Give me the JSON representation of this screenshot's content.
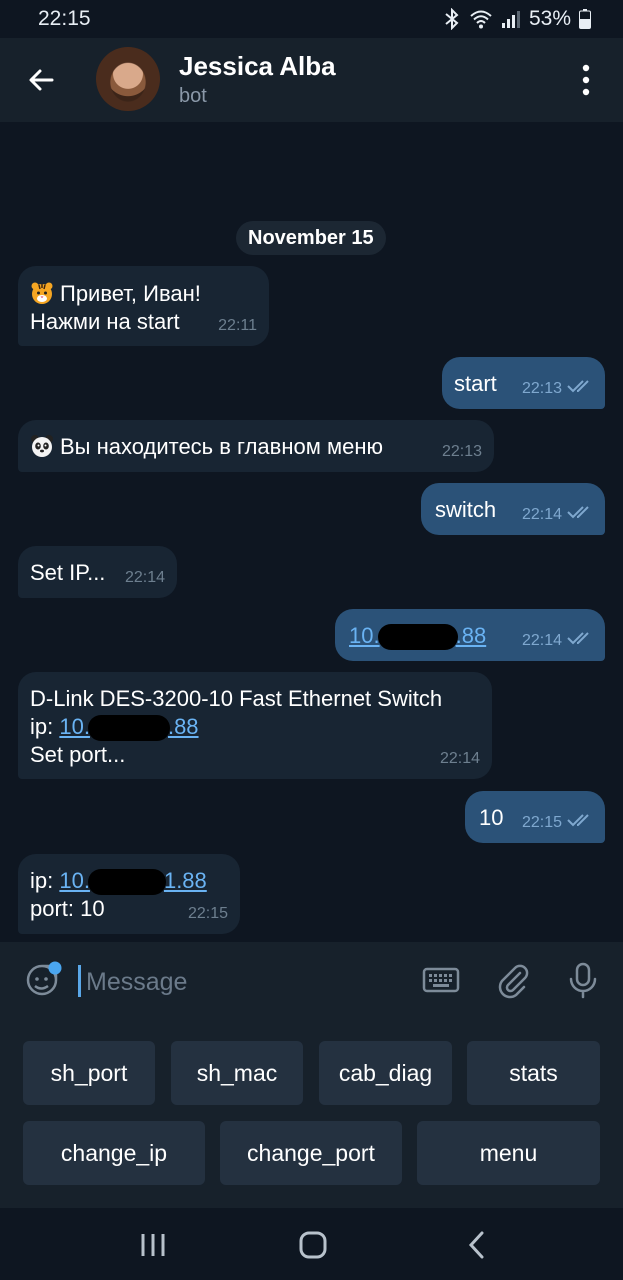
{
  "status_bar": {
    "time": "22:15",
    "battery": "53%",
    "icons": [
      "bluetooth-icon",
      "wifi-icon",
      "signal-icon",
      "battery-icon"
    ]
  },
  "header": {
    "name": "Jessica Alba",
    "subtitle": "bot",
    "icons": [
      "back-arrow-icon",
      "more-vert-icon"
    ]
  },
  "chat": {
    "date": "November 15",
    "messages": [
      {
        "dir": "in",
        "emoji": "tiger-face-emoji",
        "line1": "Привет, Иван!",
        "line2": "Нажми на start",
        "time": "22:11"
      },
      {
        "dir": "out",
        "text": "start",
        "time": "22:13"
      },
      {
        "dir": "in",
        "emoji": "panda-face-emoji",
        "text": "Вы находитесь в главном меню",
        "time": "22:13"
      },
      {
        "dir": "out",
        "text": "switch",
        "time": "22:14"
      },
      {
        "dir": "in",
        "text": "Set IP...",
        "time": "22:14"
      },
      {
        "dir": "out",
        "link_start": "10.",
        "link_end": ".88",
        "time": "22:14"
      },
      {
        "dir": "in",
        "line1": "D-Link DES-3200-10 Fast Ethernet Switch",
        "ip_label": "ip: ",
        "link_start": "10.",
        "link_end": ".88",
        "line3": "Set port...",
        "time": "22:14"
      },
      {
        "dir": "out",
        "text": "10",
        "time": "22:15"
      },
      {
        "dir": "in",
        "ip_label": "ip: ",
        "link_start": "10.",
        "link_end": "1.88",
        "line2": "port: 10",
        "time": "22:15"
      }
    ]
  },
  "input": {
    "placeholder": "Message",
    "icons": [
      "sticker-icon",
      "keyboard-icon",
      "attach-icon",
      "mic-icon"
    ]
  },
  "keyboard": {
    "row1": [
      "sh_port",
      "sh_mac",
      "cab_diag",
      "stats"
    ],
    "row2": [
      "change_ip",
      "change_port",
      "menu"
    ]
  },
  "navbar": {
    "icons": [
      "recents-icon",
      "home-icon",
      "back-nav-icon"
    ]
  },
  "colors": {
    "background": "#0e1621",
    "header": "#17212b",
    "incoming": "#182533",
    "outgoing": "#2b5278",
    "link": "#6ab3f3",
    "accent": "#5aa7e8"
  }
}
